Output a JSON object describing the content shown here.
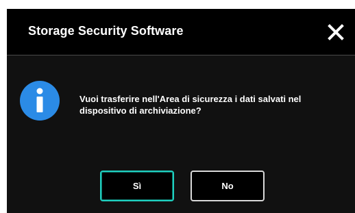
{
  "dialog": {
    "title": "Storage Security Software",
    "close_icon": "close-icon",
    "info_icon": "info-icon",
    "message": "Vuoi trasferire nell'Area di sicurezza i dati salvati nel dispositivo di archiviazione?",
    "yes_label": "Sì",
    "no_label": "No"
  },
  "colors": {
    "background": "#000000",
    "body_background": "#111111",
    "accent_focus": "#1fd0c0",
    "info_blue": "#2b8be6",
    "text": "#ffffff"
  }
}
